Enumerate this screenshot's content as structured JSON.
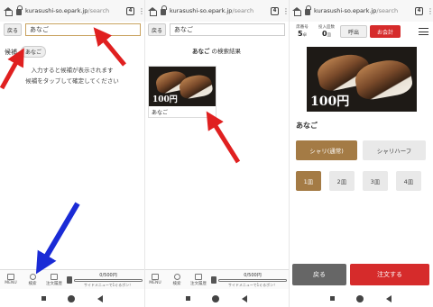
{
  "browser": {
    "url_host": "kurasushi-so.epark.jp",
    "url_path": "/search",
    "url_path_short": "/search",
    "tab_count": "4"
  },
  "panel1": {
    "back_label": "戻る",
    "search_value": "あなご",
    "candidates_label": "候補",
    "candidate_chip": "あなご",
    "hint_line1": "入力すると候補が表示されます",
    "hint_line2": "候補をタップして確定してください"
  },
  "panel2": {
    "back_label": "戻る",
    "search_value": "あなご",
    "result_keyword": "あなご",
    "result_suffix": "の検索結果",
    "card_price": "100円",
    "card_name": "あなご"
  },
  "bottom_nav": {
    "menu_label": "MENU",
    "search_label": "検索",
    "history_label": "注文履歴",
    "progress_text": "0/500円",
    "progress_note": "サイドメニューで1ぐるポン！",
    "progress_value": 0
  },
  "panel3": {
    "seat_label": "席番号",
    "seat_value": "5",
    "seat_unit": "卓",
    "guests_label": "投入皿数",
    "guests_value": "0",
    "guests_unit": "皿",
    "call_label": "呼出",
    "checkout_label": "お会計",
    "hero_price": "100円",
    "item_name": "あなご",
    "rice_options": [
      "シャリ(通常)",
      "シャリハーフ"
    ],
    "plate_options": [
      "1皿",
      "2皿",
      "3皿",
      "4皿"
    ],
    "back_label": "戻る",
    "order_label": "注文する"
  },
  "colors": {
    "accent_gold": "#a47b45",
    "accent_red": "#d62b2b",
    "arrow_red": "#e02020",
    "arrow_blue": "#1a2bd6"
  }
}
